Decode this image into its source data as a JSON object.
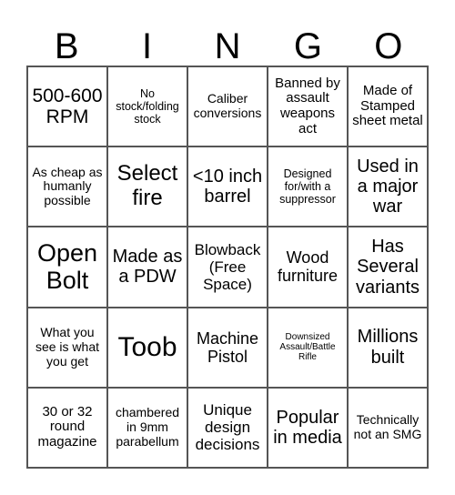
{
  "header": {
    "letters": [
      "B",
      "I",
      "N",
      "G",
      "O"
    ]
  },
  "grid": {
    "rows": [
      [
        "500-600 RPM",
        "No stock/folding stock",
        "Caliber conversions",
        "Banned by assault weapons act",
        "Made of Stamped sheet metal"
      ],
      [
        "As cheap as humanly possible",
        "Select fire",
        "<10 inch barrel",
        "Designed for/with a suppressor",
        "Used in a major war"
      ],
      [
        "Open Bolt",
        "Made as a PDW",
        "Blowback (Free Space)",
        "Wood furniture",
        "Has Several variants"
      ],
      [
        "What you see is what you get",
        "Toob",
        "Machine Pistol",
        "Downsized Assault/Battle Rifle",
        "Millions built"
      ],
      [
        "30 or 32 round magazine",
        "chambered in 9mm parabellum",
        "Unique design decisions",
        "Popular in media",
        "Technically not an SMG"
      ]
    ],
    "free_space": {
      "row": 2,
      "col": 2
    }
  }
}
